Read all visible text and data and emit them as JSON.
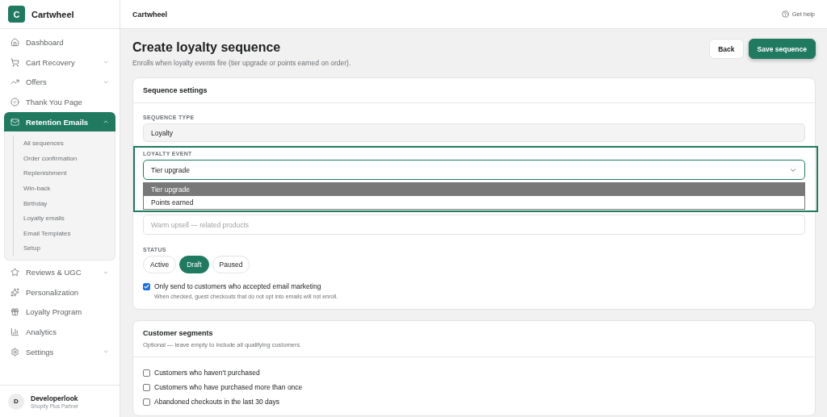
{
  "sidebar": {
    "brand": {
      "initial": "C",
      "name": "Cartwheel"
    },
    "items": [
      {
        "label": "Dashboard",
        "expandable": false,
        "selected": false
      },
      {
        "label": "Cart Recovery",
        "expandable": true,
        "selected": false
      },
      {
        "label": "Offers",
        "expandable": true,
        "selected": false
      },
      {
        "label": "Thank You Page",
        "expandable": false,
        "selected": false
      },
      {
        "label": "Retention Emails",
        "expandable": true,
        "expanded": true,
        "selected": true,
        "children": [
          {
            "label": "All sequences"
          },
          {
            "label": "Order confirmation"
          },
          {
            "label": "Replenishment"
          },
          {
            "label": "Win-back"
          },
          {
            "label": "Birthday"
          },
          {
            "label": "Loyalty emails"
          },
          {
            "label": "Email Templates"
          },
          {
            "label": "Setup"
          }
        ]
      },
      {
        "label": "Reviews & UGC",
        "expandable": true,
        "selected": false
      },
      {
        "label": "Personalization",
        "expandable": false,
        "selected": false
      },
      {
        "label": "Loyalty Program",
        "expandable": false,
        "selected": false
      },
      {
        "label": "Analytics",
        "expandable": false,
        "selected": false
      },
      {
        "label": "Settings",
        "expandable": true,
        "selected": false
      }
    ],
    "user": {
      "initial": "D",
      "name": "Developerlook",
      "role": "Shopify Plus Partner"
    }
  },
  "topbar": {
    "title": "Cartwheel",
    "help": "Get help"
  },
  "header": {
    "title": "Create loyalty sequence",
    "subtitle": "Enrolls when loyalty events fire (tier upgrade or points earned on order).",
    "buttons": [
      {
        "label": "Back",
        "kind": "secondary"
      },
      {
        "label": "Save sequence",
        "kind": "primary"
      }
    ]
  },
  "settings_card": {
    "title": "Sequence settings",
    "sequence_type": {
      "label": "SEQUENCE TYPE",
      "value": "Loyalty"
    },
    "loyalty_event": {
      "label": "LOYALTY EVENT",
      "value": "Tier upgrade",
      "open": true,
      "options": [
        {
          "label": "Tier upgrade",
          "selected": true
        },
        {
          "label": "Points earned",
          "selected": false
        }
      ]
    },
    "name": {
      "placeholder": "Warm upsell — related products"
    },
    "status": {
      "label": "STATUS",
      "options": [
        {
          "label": "Active",
          "selected": false
        },
        {
          "label": "Draft",
          "selected": true
        },
        {
          "label": "Paused",
          "selected": false
        }
      ]
    },
    "email_opt_in": {
      "label": "Only send to customers who accepted email marketing",
      "checked": true,
      "hint": "When checked, guest checkouts that do not opt into emails will not enroll."
    }
  },
  "segments_card": {
    "title": "Customer segments",
    "subtitle": "Optional — leave empty to include all qualifying customers.",
    "options": [
      {
        "label": "Customers who haven't purchased",
        "checked": false
      },
      {
        "label": "Customers who have purchased more than once",
        "checked": false
      },
      {
        "label": "Abandoned checkouts in the last 30 days",
        "checked": false
      }
    ]
  }
}
